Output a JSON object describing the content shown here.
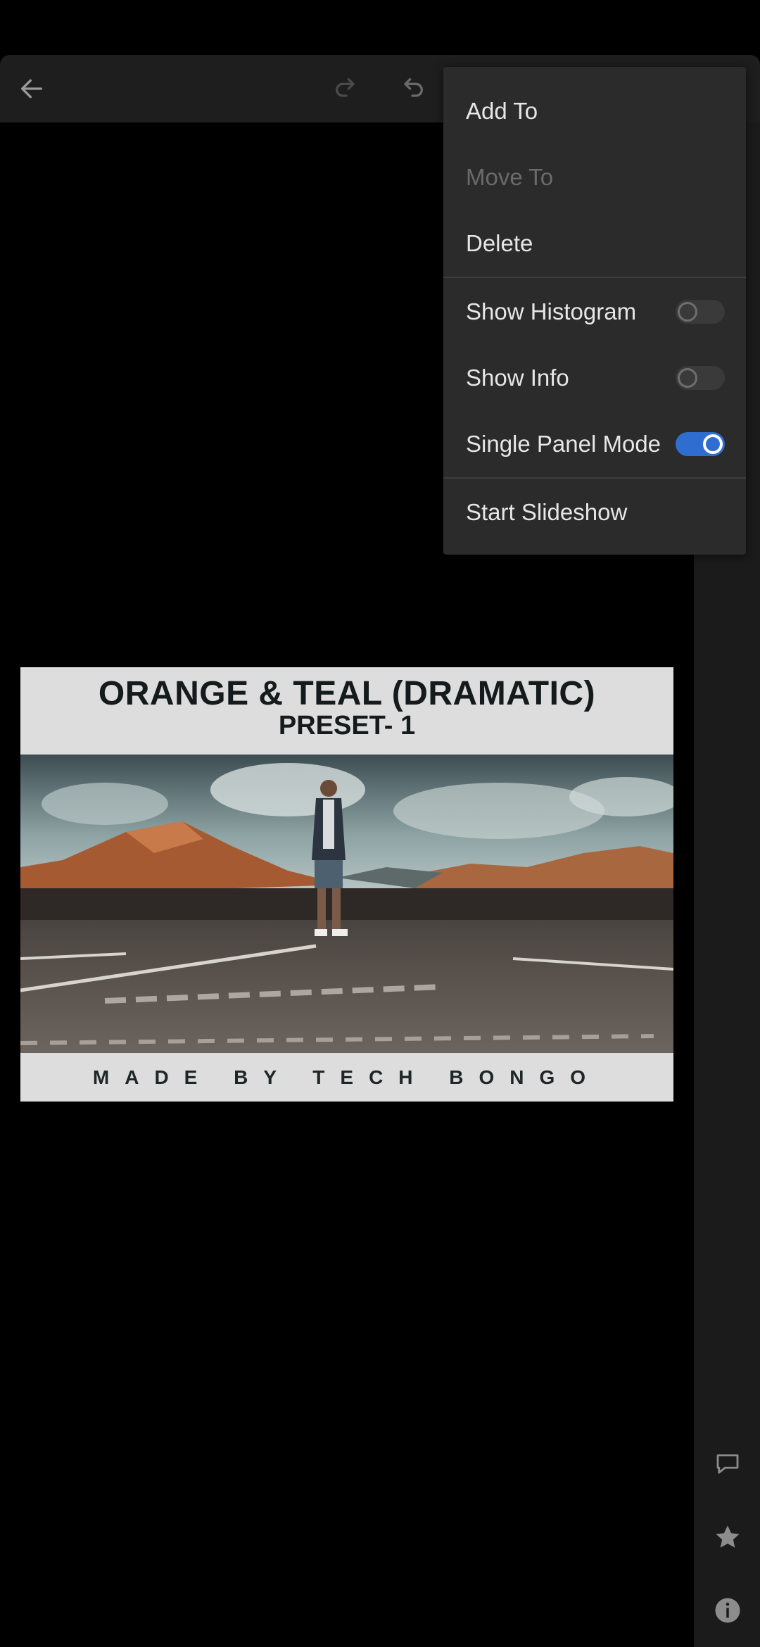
{
  "toolbar": {
    "back_icon": "arrow-left-icon",
    "redo_icon": "redo-icon",
    "undo_icon": "undo-icon"
  },
  "menu": {
    "items": [
      {
        "label": "Add To",
        "enabled": true
      },
      {
        "label": "Move To",
        "enabled": false
      },
      {
        "label": "Delete",
        "enabled": true
      }
    ],
    "toggles": [
      {
        "label": "Show Histogram",
        "on": false
      },
      {
        "label": "Show Info",
        "on": false
      },
      {
        "label": "Single Panel Mode",
        "on": true
      }
    ],
    "slideshow_label": "Start Slideshow"
  },
  "photo": {
    "title": "ORANGE & TEAL (DRAMATIC)",
    "subtitle": "PRESET- 1",
    "footer": "MADE BY TECH BONGO"
  },
  "side_panel": {
    "icons": [
      "comment-icon",
      "star-icon",
      "info-icon"
    ]
  },
  "colors": {
    "accent": "#2f6dd0",
    "menu_bg": "#2b2b2b",
    "toolbar_bg": "#1e1e1e"
  }
}
